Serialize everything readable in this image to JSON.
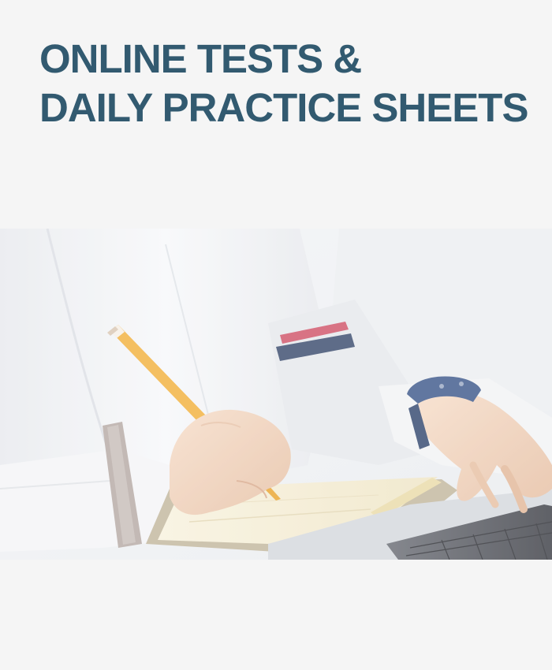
{
  "heading": {
    "line1": "ONLINE TESTS &",
    "line2": "DAILY PRACTICE SHEETS"
  },
  "colors": {
    "background": "#f5f5f5",
    "heading_text": "#325a70",
    "pencil": "#f2b13f",
    "sleeve_stripe_red": "#d0556a",
    "sleeve_stripe_navy": "#3b4c6e",
    "watch_strap": "#3f5a8c",
    "laptop": "#3d3f46"
  },
  "photo": {
    "icons": [
      "pencil-icon",
      "notebook-icon",
      "laptop-icon",
      "wristwatch-icon"
    ]
  }
}
